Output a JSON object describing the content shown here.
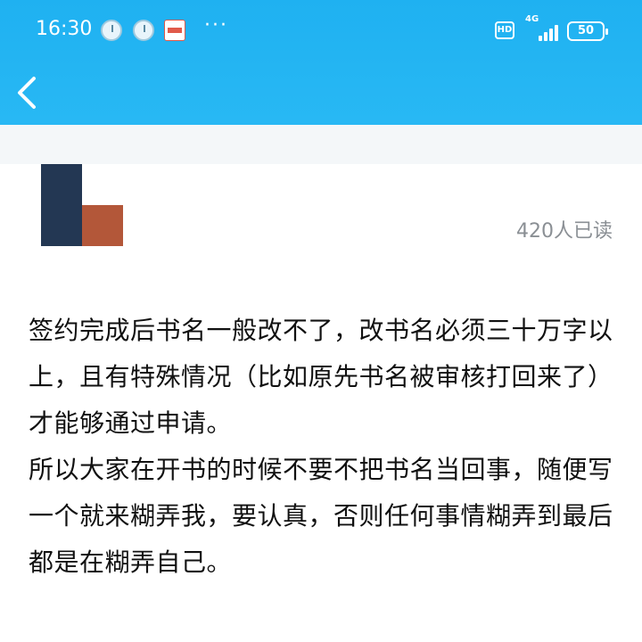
{
  "status_bar": {
    "time": "16:30",
    "dots": "···",
    "hd": "HD",
    "network": "4G",
    "battery": "50"
  },
  "header": {
    "back_icon": "chevron-left-icon",
    "accent_color": "#1fb1f1"
  },
  "post": {
    "read_count": "420人已读",
    "paragraphs": [
      "签约完成后书名一般改不了，改书名必须三十万字以上，且有特殊情况（比如原先书名被审核打回来了）才能够通过申请。",
      "所以大家在开书的时候不要不把书名当回事，随便写一个就来糊弄我，要认真，否则任何事情糊弄到最后都是在糊弄自己。"
    ]
  },
  "logo": {
    "colors": [
      "#233753",
      "#b35739"
    ]
  }
}
